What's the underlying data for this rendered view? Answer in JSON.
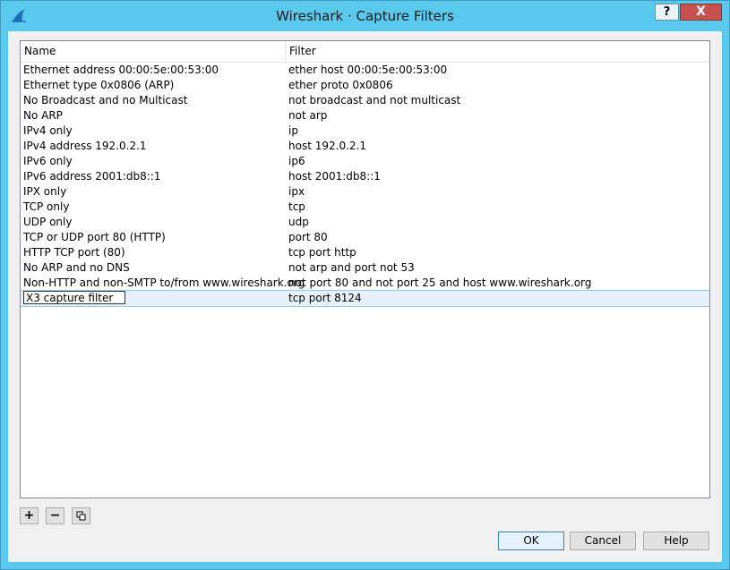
{
  "window": {
    "title": "Wireshark · Capture Filters",
    "help_label": "?",
    "close_label": "X"
  },
  "table": {
    "columns": [
      "Name",
      "Filter"
    ],
    "rows": [
      {
        "name": "Ethernet address 00:00:5e:00:53:00",
        "filter": "ether host 00:00:5e:00:53:00"
      },
      {
        "name": "Ethernet type 0x0806 (ARP)",
        "filter": "ether proto 0x0806"
      },
      {
        "name": "No Broadcast and no Multicast",
        "filter": "not broadcast and not multicast"
      },
      {
        "name": "No ARP",
        "filter": "not arp"
      },
      {
        "name": "IPv4 only",
        "filter": "ip"
      },
      {
        "name": "IPv4 address 192.0.2.1",
        "filter": "host 192.0.2.1"
      },
      {
        "name": "IPv6 only",
        "filter": "ip6"
      },
      {
        "name": "IPv6 address 2001:db8::1",
        "filter": "host 2001:db8::1"
      },
      {
        "name": "IPX only",
        "filter": "ipx"
      },
      {
        "name": "TCP only",
        "filter": "tcp"
      },
      {
        "name": "UDP only",
        "filter": "udp"
      },
      {
        "name": "TCP or UDP port 80 (HTTP)",
        "filter": "port 80"
      },
      {
        "name": "HTTP TCP port (80)",
        "filter": "tcp port http"
      },
      {
        "name": "No ARP and no DNS",
        "filter": "not arp and port not 53"
      },
      {
        "name": "Non-HTTP and non-SMTP to/from www.wireshark.org",
        "filter": "not port 80 and not port 25 and host www.wireshark.org"
      },
      {
        "name": "X3 capture filter",
        "filter": "tcp port 8124"
      }
    ]
  },
  "toolbar": {
    "add_icon": "plus-icon",
    "remove_icon": "minus-icon",
    "copy_icon": "copy-icon",
    "add_label": "+",
    "remove_label": "−"
  },
  "buttons": {
    "ok": "OK",
    "cancel": "Cancel",
    "help": "Help"
  },
  "colors": {
    "title_bar": "#59c9ee",
    "close_button": "#c7514c",
    "selection": "#e6f1fc"
  }
}
